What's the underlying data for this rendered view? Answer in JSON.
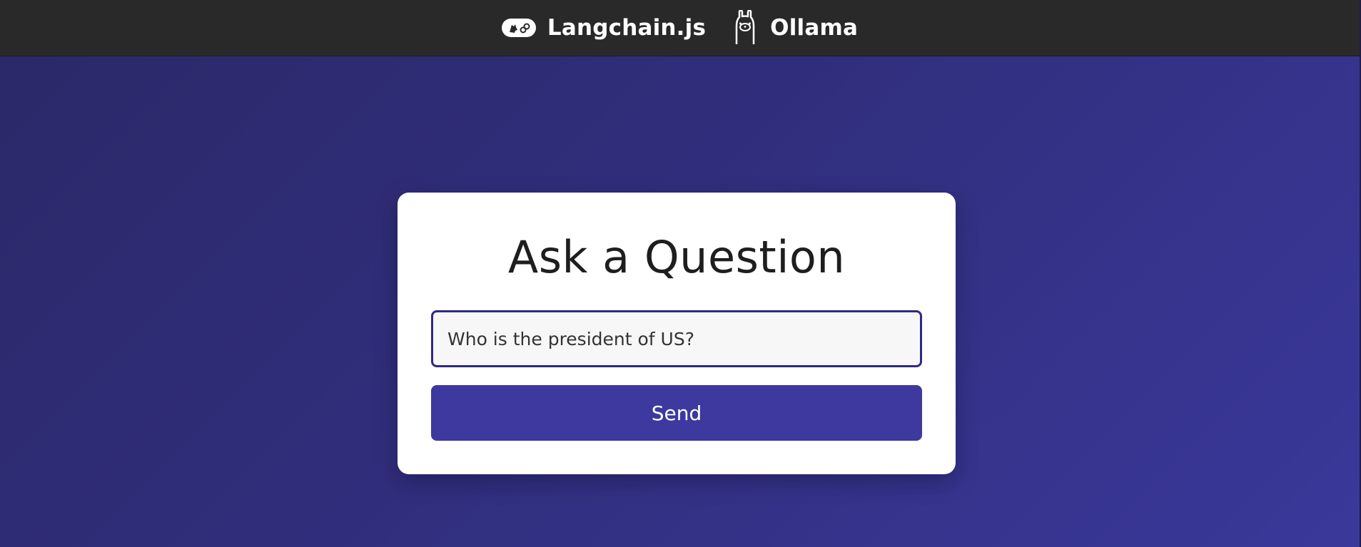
{
  "header": {
    "brands": [
      {
        "label": "Langchain.js",
        "icon": "langchain-logo-icon"
      },
      {
        "label": "Ollama",
        "icon": "ollama-llama-icon"
      }
    ]
  },
  "card": {
    "title": "Ask a Question",
    "input": {
      "value": "Who is the president of US?",
      "placeholder": ""
    },
    "send_label": "Send"
  },
  "colors": {
    "header_bg": "#2a2929",
    "page_bg_start": "#2b2868",
    "page_bg_end": "#3a389a",
    "button_bg": "#3d399f",
    "input_border": "#2e2a84"
  }
}
